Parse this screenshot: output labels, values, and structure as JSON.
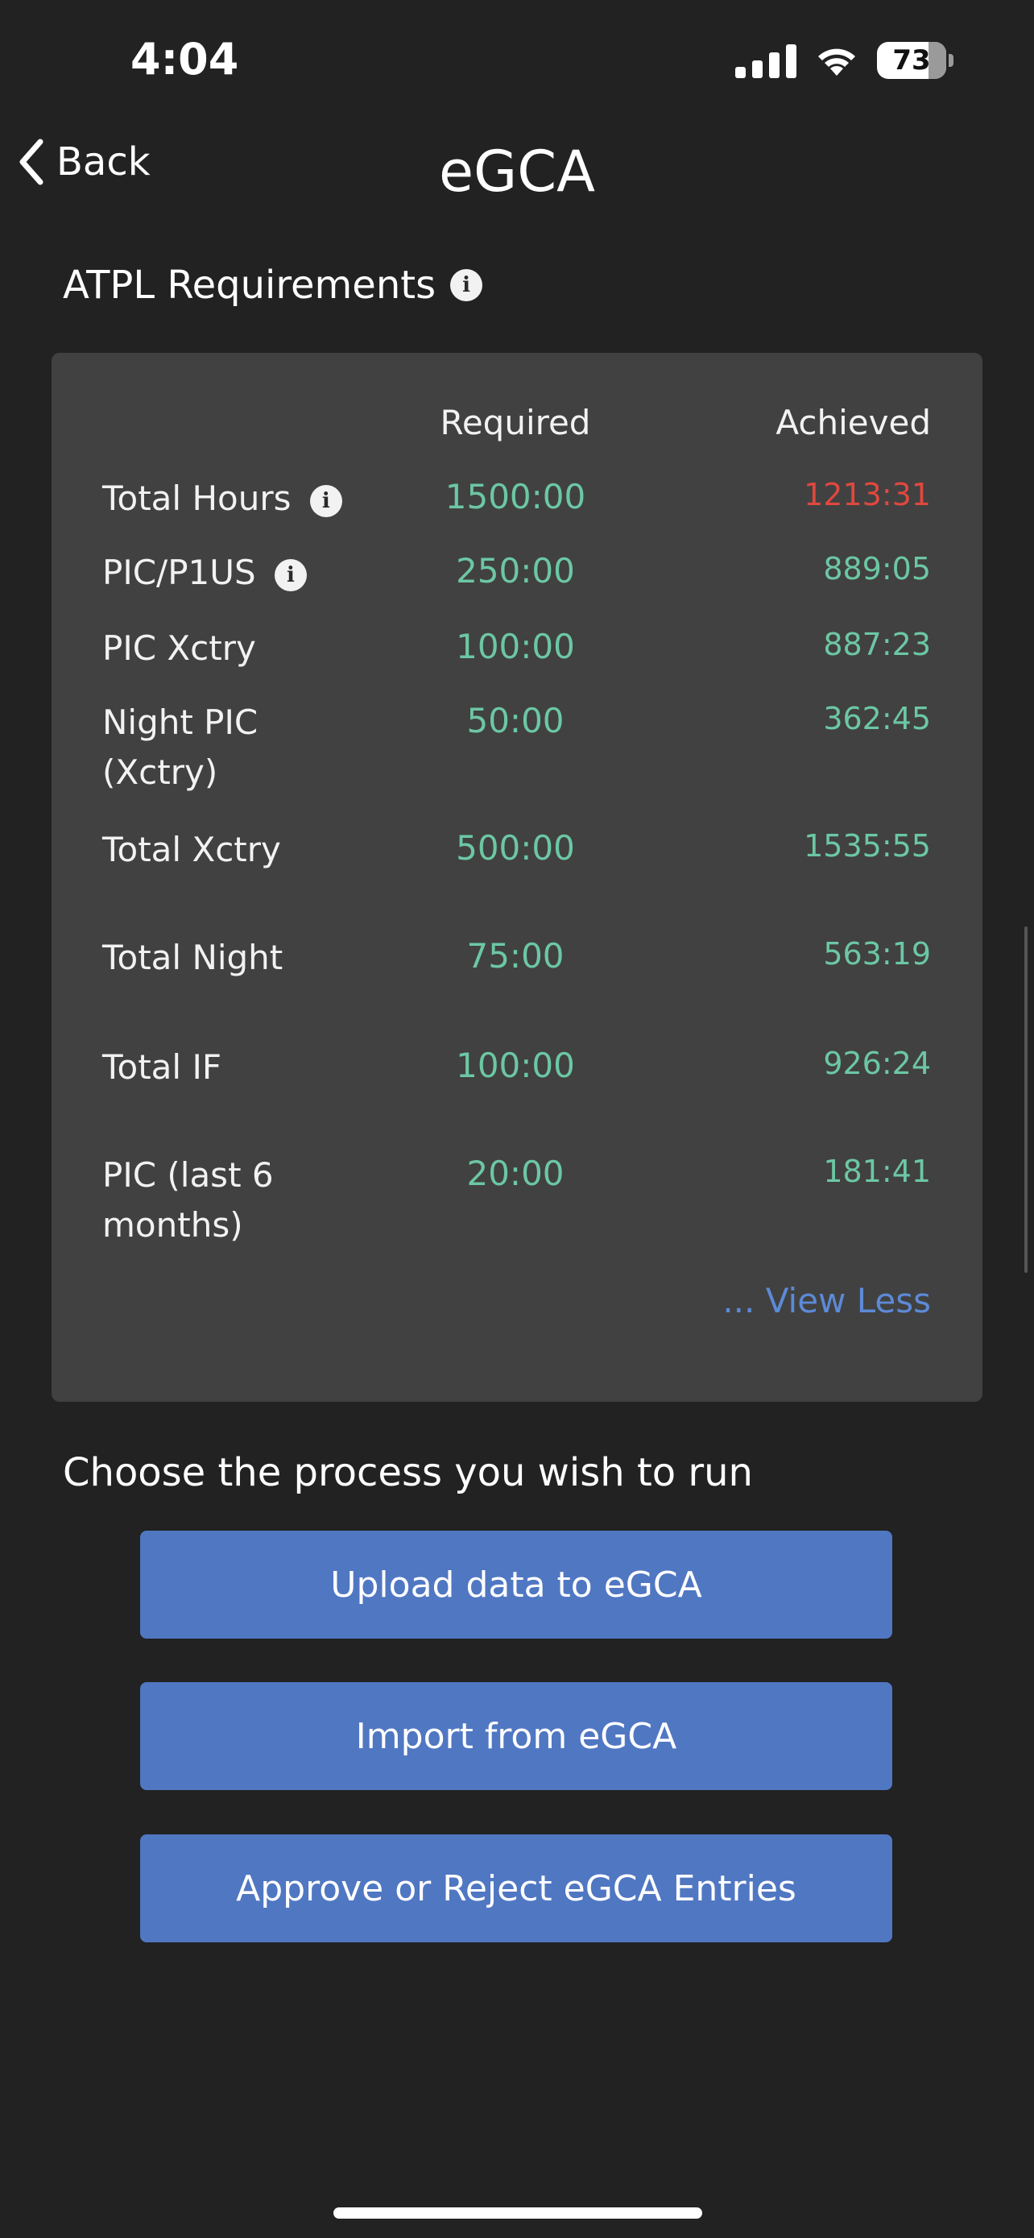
{
  "status_bar": {
    "time": "4:04",
    "battery": "73"
  },
  "nav": {
    "back_label": "Back",
    "title": "eGCA"
  },
  "section": {
    "title": "ATPL Requirements"
  },
  "table": {
    "headers": {
      "required": "Required",
      "achieved": "Achieved"
    },
    "rows": [
      {
        "label": "Total Hours",
        "required": "1500:00",
        "achieved": "1213:31"
      },
      {
        "label": "PIC/P1US",
        "required": "250:00",
        "achieved": "889:05"
      },
      {
        "label": "PIC Xctry",
        "required": "100:00",
        "achieved": "887:23"
      },
      {
        "label": "Night PIC (Xctry)",
        "required": "50:00",
        "achieved": "362:45"
      },
      {
        "label": "Total Xctry",
        "required": "500:00",
        "achieved": "1535:55"
      },
      {
        "label": "Total Night",
        "required": "75:00",
        "achieved": "563:19"
      },
      {
        "label": "Total IF",
        "required": "100:00",
        "achieved": "926:24"
      },
      {
        "label": "PIC (last 6 months)",
        "required": "20:00",
        "achieved": "181:41"
      }
    ],
    "view_less": "... View Less"
  },
  "process": {
    "prompt": "Choose the process you wish to run",
    "buttons": [
      "Upload data to eGCA",
      "Import from eGCA",
      "Approve or Reject eGCA Entries"
    ]
  },
  "colors": {
    "achieved_ok": "#6cc7a4",
    "achieved_short": "#e0483e",
    "button": "#5077c2",
    "link": "#5c8ad6"
  },
  "icons": [
    "signal-icon",
    "wifi-icon",
    "battery-icon",
    "chevron-left-icon",
    "info-icon"
  ]
}
